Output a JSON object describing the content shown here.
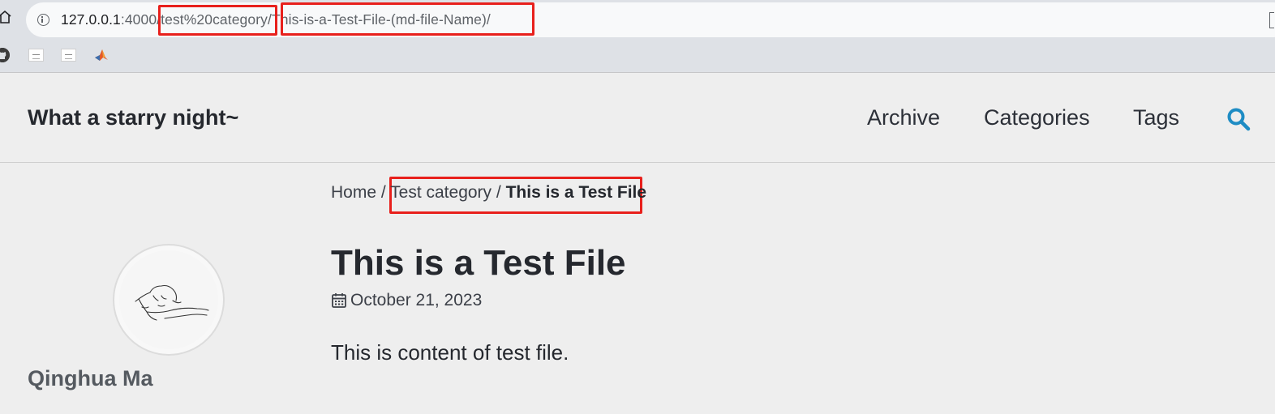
{
  "browser": {
    "url_host": "127.0.0.1",
    "url_rest": ":4000/test%20category/This-is-a-Test-File-(md-file-Name)/"
  },
  "site": {
    "title": "What a starry night~",
    "nav": [
      "Archive",
      "Categories",
      "Tags"
    ]
  },
  "breadcrumb": {
    "home": "Home",
    "sep": " / ",
    "category": "Test category",
    "current": "This is a Test File"
  },
  "sidebar": {
    "author": "Qinghua Ma"
  },
  "post": {
    "title": "This is a Test File",
    "date": "October 21, 2023",
    "content": "This is content of test file."
  },
  "colors": {
    "accent": "#1e8cc4",
    "annotation": "#e8201c"
  }
}
